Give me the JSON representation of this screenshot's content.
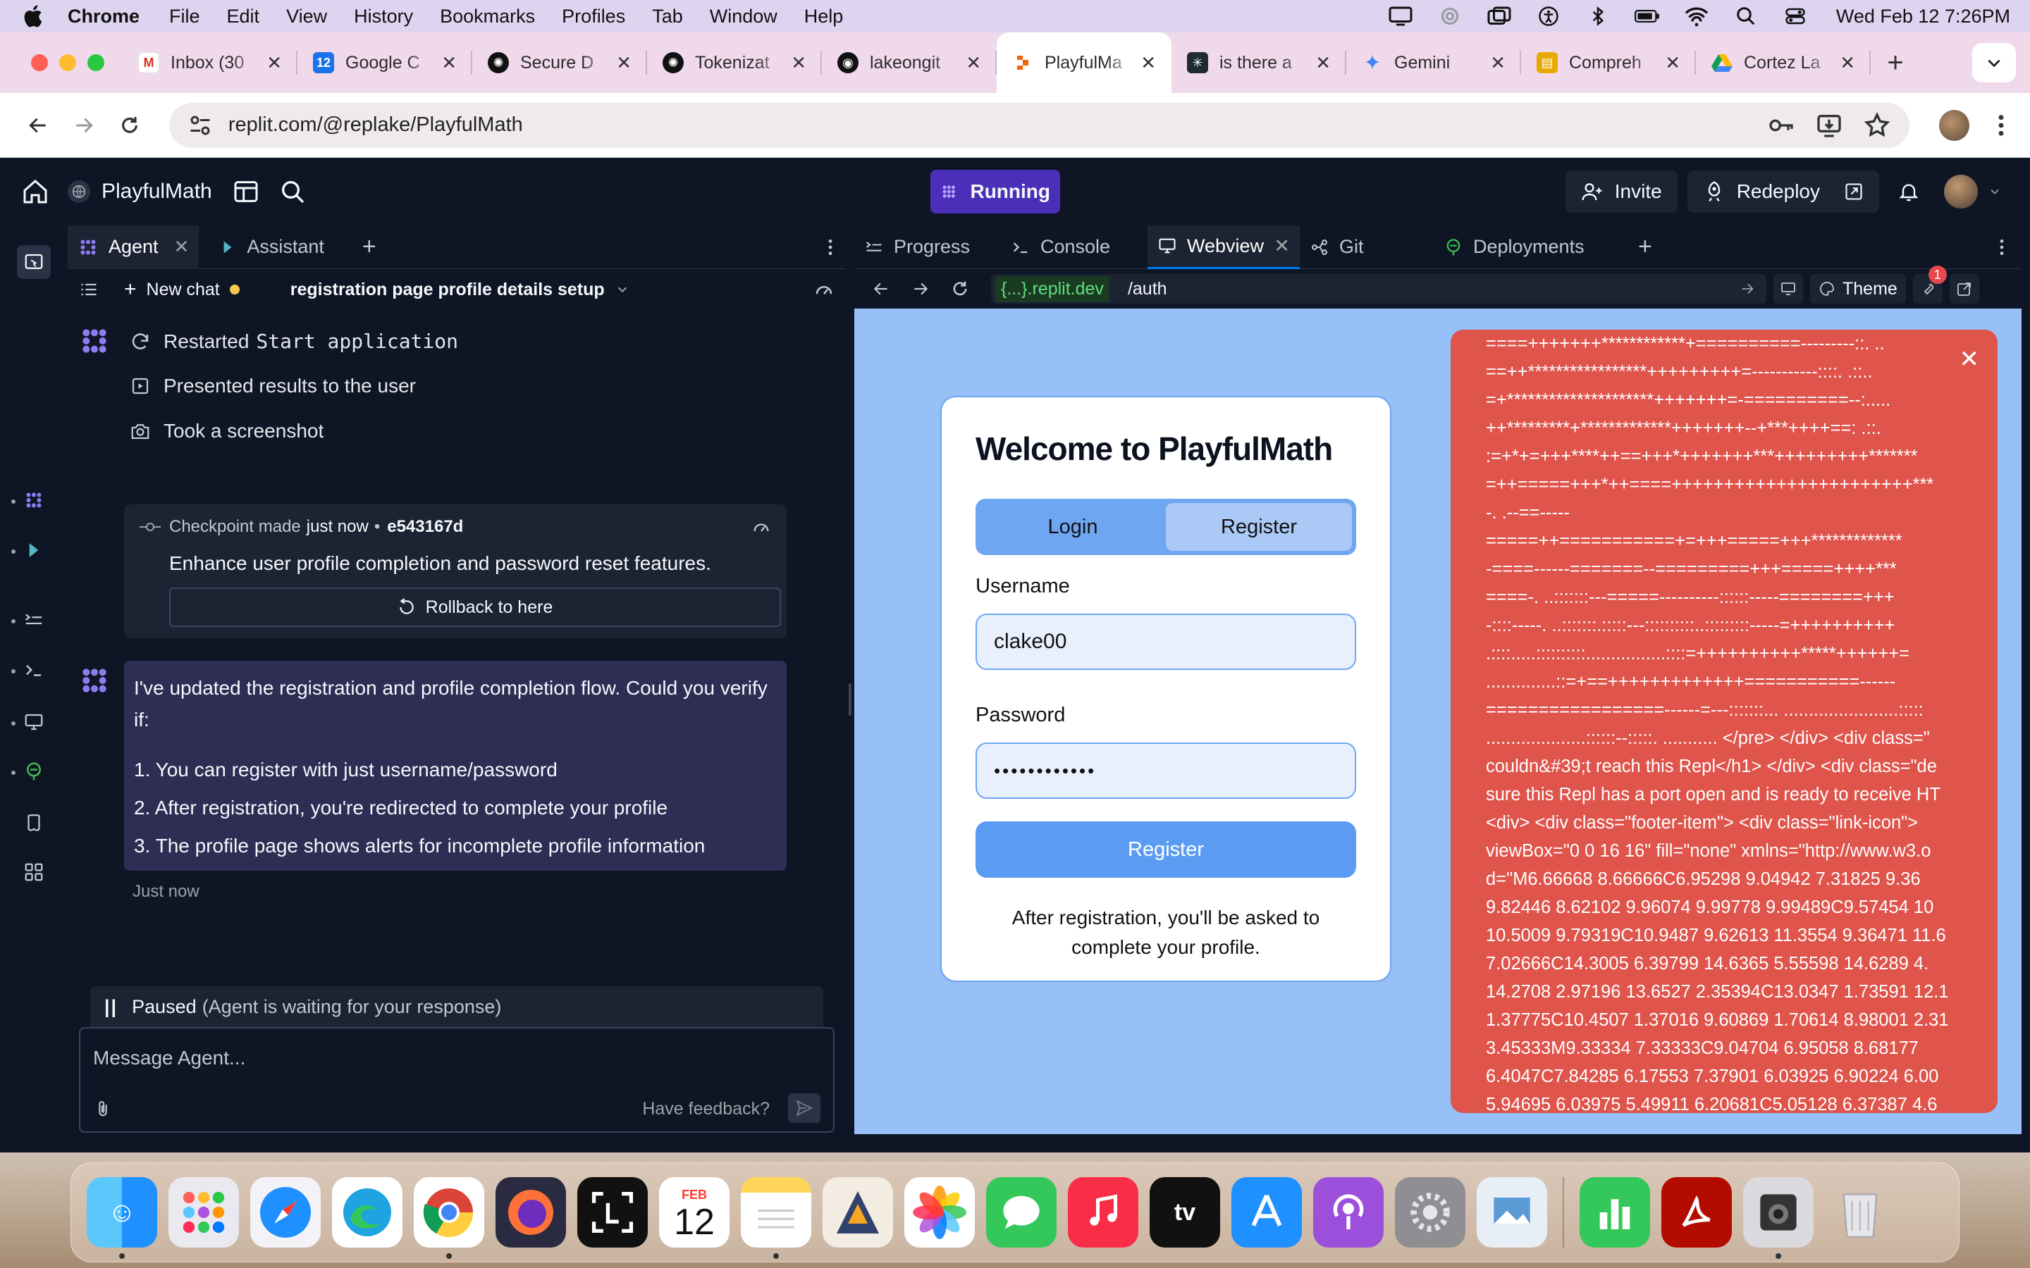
{
  "menubar": {
    "app": "Chrome",
    "menus": [
      "File",
      "Edit",
      "View",
      "History",
      "Bookmarks",
      "Profiles",
      "Tab",
      "Window",
      "Help"
    ],
    "clock": "Wed Feb 12  7:26PM"
  },
  "browser": {
    "tabs": [
      {
        "title": "Inbox (30",
        "icon": "gmail-icon",
        "color": "#d93025"
      },
      {
        "title": "Google C",
        "icon": "google-calendar-icon",
        "color": "#1a73e8"
      },
      {
        "title": "Secure D",
        "icon": "openai-icon",
        "color": "#111111"
      },
      {
        "title": "Tokenizat",
        "icon": "openai-icon",
        "color": "#111111"
      },
      {
        "title": "lakeongit",
        "icon": "github-icon",
        "color": "#111111"
      },
      {
        "title": "PlayfulMa",
        "icon": "replit-icon",
        "color": "#f26207",
        "active": true
      },
      {
        "title": "is there a",
        "icon": "perplexity-icon",
        "color": "#1f2a33"
      },
      {
        "title": "Gemini",
        "icon": "gemini-icon",
        "color": "#4285f4"
      },
      {
        "title": "Compreh",
        "icon": "notes-icon",
        "color": "#e8a900"
      },
      {
        "title": "Cortez La",
        "icon": "google-drive-icon",
        "color": "#0f9d58"
      }
    ],
    "url": "replit.com/@replake/PlayfulMath"
  },
  "replit": {
    "repl_name": "PlayfulMath",
    "run_label": "Running",
    "invite_label": "Invite",
    "redeploy_label": "Redeploy",
    "left_tabs": {
      "agent": "Agent",
      "assistant": "Assistant"
    },
    "chat": {
      "new_chat": "New chat",
      "name": "registration page profile details setup"
    },
    "actions": [
      {
        "icon": "refresh-icon",
        "text": "Restarted",
        "code": "Start application"
      },
      {
        "icon": "presentation-icon",
        "text": "Presented results to the user"
      },
      {
        "icon": "camera-icon",
        "text": "Took a screenshot"
      }
    ],
    "checkpoint": {
      "label": "Checkpoint made",
      "time": "just now",
      "bullet": "•",
      "hash": "e543167d",
      "description": "Enhance user profile completion and password reset features.",
      "rollback": "Rollback to here"
    },
    "message": {
      "intro": "I've updated the registration and profile completion flow. Could you verify if:",
      "items": [
        "1. You can register with just username/password",
        "2. After registration, you're redirected to complete your profile",
        "3. The profile page shows alerts for incomplete profile information"
      ],
      "time": "Just now"
    },
    "paused": {
      "label": "Paused",
      "detail": "(Agent is waiting for your response)"
    },
    "composer": {
      "placeholder": "Message Agent...",
      "feedback": "Have feedback?"
    },
    "right_tabs": {
      "progress": "Progress",
      "console": "Console",
      "webview": "Webview",
      "git": "Git",
      "deployments": "Deployments"
    },
    "webview": {
      "domain": "{...}.replit.dev",
      "path": "/auth",
      "theme": "Theme",
      "badge": "1"
    }
  },
  "app_page": {
    "title": "Welcome to PlayfulMath",
    "tab_login": "Login",
    "tab_register": "Register",
    "username_label": "Username",
    "username_value": "clake00",
    "password_label": "Password",
    "password_value": "••••••••••••",
    "submit": "Register",
    "note": "After registration, you'll be asked to complete your profile."
  },
  "error_overlay": {
    "lines": [
      "====+++++++************+==========---------::. ..",
      "==++*****************+++++++++=-----------::::. .::..",
      "=+*********************+++++++=-==========--:.....",
      "++*********+*************+++++++--+***++++==: .::.",
      ":=+*+=+++****++==+++*+++++++***+++++++++*******",
      "=++=====+++*++====+++++++++++++++++++++++***",
      "-. .--==-----",
      "=====++===========+=+++=====+++*************",
      "-====------=======--=========+++=====++++***",
      "====-. ..:::::::---=====----------::::::-----========+++",
      "-::::-----. ..:::::::.:::::---::::::::::..:::::::::-----=++++++++++",
      ".::::.....::::::::::................::::=++++++++++*****++++++=",
      "..............::=+==+++++++++++++===========------",
      "=================------=---:::::::... .......................:::::",
      "....................::::::--:::::. ........... </pre> </div> <div class=\"",
      "couldn&#39;t reach this Repl</h1> </div> <div class=\"de",
      "sure this Repl has a port open and is ready to receive HT",
      "<div> <div class=\"footer-item\"> <div class=\"link-icon\">",
      "viewBox=\"0 0 16 16\" fill=\"none\" xmlns=\"http://www.w3.o",
      "d=\"M6.66668 8.66666C6.95298 9.04942 7.31825 9.36",
      "9.82446 8.62102 9.96074 9.99778 9.99489C9.57454 10",
      "10.5009 9.79319C10.9487 9.62613 11.3554 9.36471 11.6",
      "7.02666C14.3005 6.39799 14.6365 5.55598 14.6289 4.",
      "14.2708 2.97196 13.6527 2.35394C13.0347 1.73591 12.1",
      "1.37775C10.4507 1.37016 9.60869 1.70614 8.98001 2.31",
      "3.45333M9.33334 7.33333C9.04704 6.95058 8.68177",
      "6.4047C7.84285 6.17553 7.37901 6.03925 6.90224 6.00",
      "5.94695 6.03975 5.49911 6.20681C5.05128 6.37387 4.6"
    ]
  },
  "dock": {
    "calendar_month": "FEB",
    "calendar_day": "12",
    "apps": [
      "finder-icon",
      "launchpad-icon",
      "safari-icon",
      "edge-icon",
      "chrome-icon",
      "firefox-icon",
      "screenshot-icon",
      "calendar-icon",
      "notes-icon",
      "linear-icon",
      "photos-icon",
      "messages-icon",
      "music-icon",
      "appletv-icon",
      "appstore-icon",
      "podcasts-icon",
      "settings-icon",
      "preview-icon",
      "numbers-icon",
      "acrobat-icon",
      "image-capture-icon",
      "trash-icon"
    ]
  },
  "colors": {
    "replit_bg": "#0e1525",
    "replit_surface": "#1c2333",
    "running": "#4b2fb8",
    "webview_bg": "#97c0f7",
    "primary_button": "#5b9cf2",
    "error_panel": "#df544b"
  }
}
